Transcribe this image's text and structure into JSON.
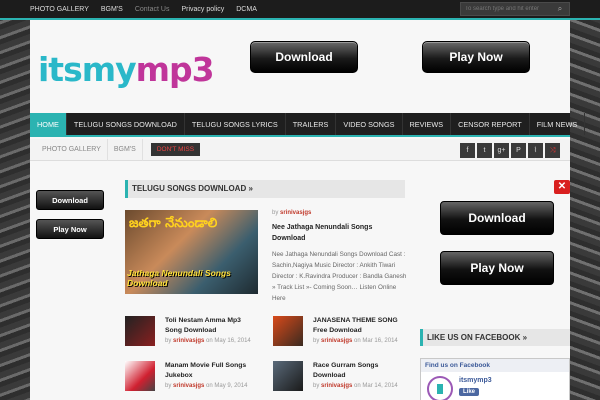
{
  "topbar": {
    "nav": [
      "PHOTO GALLERY",
      "BGM'S",
      "Contact Us",
      "Privacy policy",
      "DCMA"
    ],
    "search_placeholder": "To search type and hit enter"
  },
  "logo": {
    "part1": "itsmy",
    "part2": "mp3"
  },
  "header_buttons": {
    "download": "Download",
    "play": "Play Now"
  },
  "main_nav": [
    "HOME",
    "TELUGU SONGS DOWNLOAD",
    "TELUGU SONGS LYRICS",
    "TRAILERS",
    "VIDEO SONGS",
    "REVIEWS",
    "CENSOR REPORT",
    "FILM NEWS"
  ],
  "sub_nav": [
    "PHOTO GALLERY",
    "BGM'S"
  ],
  "dont_miss": "DON'T MISS",
  "social_icons": [
    "f",
    "t",
    "g+",
    "P",
    "rss",
    "shuffle"
  ],
  "left_buttons": {
    "download": "Download",
    "play": "Play Now"
  },
  "section": {
    "title": "TELUGU SONGS DOWNLOAD »"
  },
  "featured": {
    "image_text1": "జతగా నేనుండాలి",
    "image_text2": "Jathaga Nenundali Songs Download",
    "by": "by",
    "author": "srinivasjgs",
    "title": "Nee Jathaga Nenundali Songs Download",
    "excerpt": "Nee Jathaga Nenundali Songs Download Cast : Sachin,Nagiya Music Director : Ankith Tiwari Director : K.Ravindra Producer : Bandla Ganesh   » Track List »- Coming Soon… Listen Online Here"
  },
  "items": [
    {
      "title": "Toli Nestam Amma Mp3 Song Download",
      "author": "srinivasjgs",
      "date": "May 16, 2014"
    },
    {
      "title": "JANASENA THEME SONG Free Download",
      "author": "srinivasjgs",
      "date": "Mar 16, 2014"
    },
    {
      "title": "Manam Movie Full Songs Jukebox",
      "author": "srinivasjgs",
      "date": "May 9, 2014"
    },
    {
      "title": "Race Gurram Songs Download",
      "author": "srinivasjgs",
      "date": "Mar 14, 2014"
    }
  ],
  "right_buttons": {
    "download": "Download",
    "play": "Play Now"
  },
  "close_label": "✕",
  "facebook": {
    "header": "LIKE US ON FACEBOOK »",
    "find": "Find us on Facebook",
    "page_name": "itsmymp3",
    "like": "Like"
  }
}
